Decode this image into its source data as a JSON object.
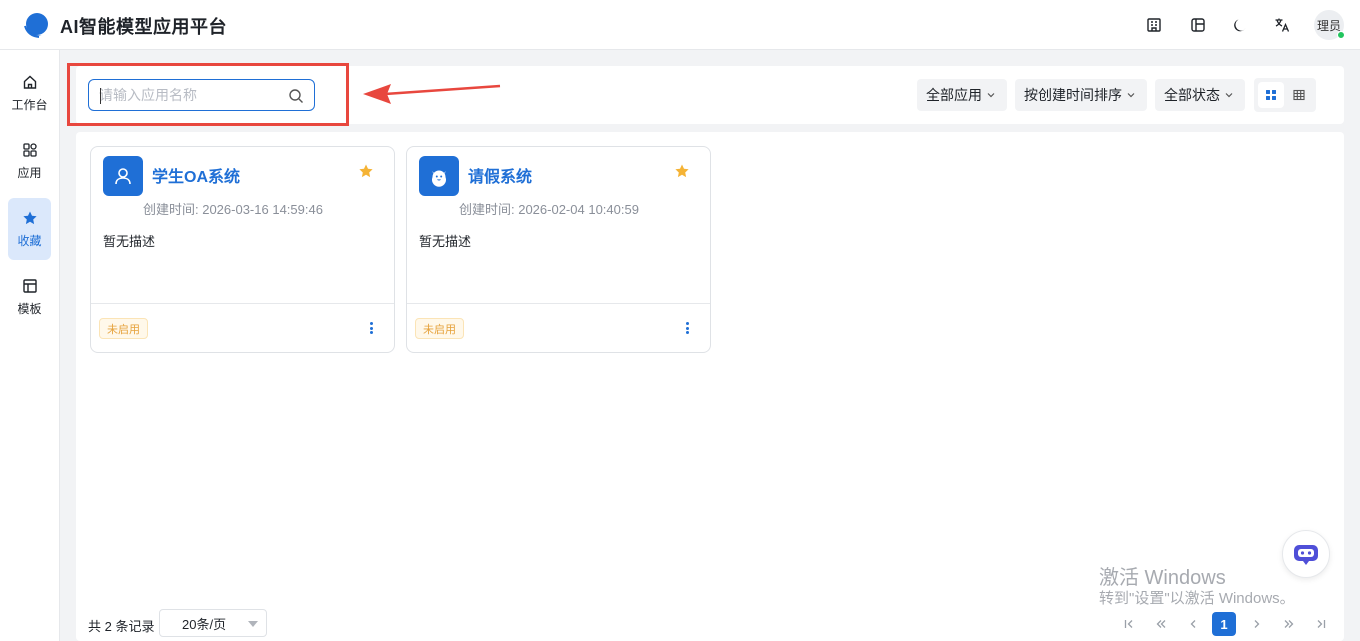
{
  "header": {
    "app_title": "AI智能模型应用平台",
    "icons": [
      "building-icon",
      "layout-icon",
      "moon-icon",
      "translate-icon"
    ],
    "avatar_text": "理员",
    "brand_color": "#1f6fd6"
  },
  "sidebar": {
    "items": [
      {
        "label": "工作台",
        "icon": "home-icon",
        "active": false
      },
      {
        "label": "应用",
        "icon": "apps-icon",
        "active": false
      },
      {
        "label": "收藏",
        "icon": "star-icon",
        "active": true
      },
      {
        "label": "模板",
        "icon": "template-icon",
        "active": false
      }
    ]
  },
  "toolbar": {
    "search_placeholder": "请输入应用名称",
    "search_value": "",
    "filter_app": "全部应用",
    "sort": "按创建时间排序",
    "filter_status": "全部状态",
    "view_mode": "grid"
  },
  "cards": [
    {
      "title": "学生OA系统",
      "time": "创建时间: 2026-03-16 14:59:46",
      "desc": "暂无描述",
      "status": "未启用",
      "icon": "user-icon",
      "favorited": true
    },
    {
      "title": "请假系统",
      "time": "创建时间: 2026-02-04 10:40:59",
      "desc": "暂无描述",
      "status": "未启用",
      "icon": "bot-face-icon",
      "favorited": true
    }
  ],
  "pagination": {
    "total_text": "共 2 条记录",
    "page_size": "20条/页",
    "current_page": "1"
  },
  "watermark": {
    "line1": "激活 Windows",
    "line2": "转到\"设置\"以激活 Windows。"
  }
}
